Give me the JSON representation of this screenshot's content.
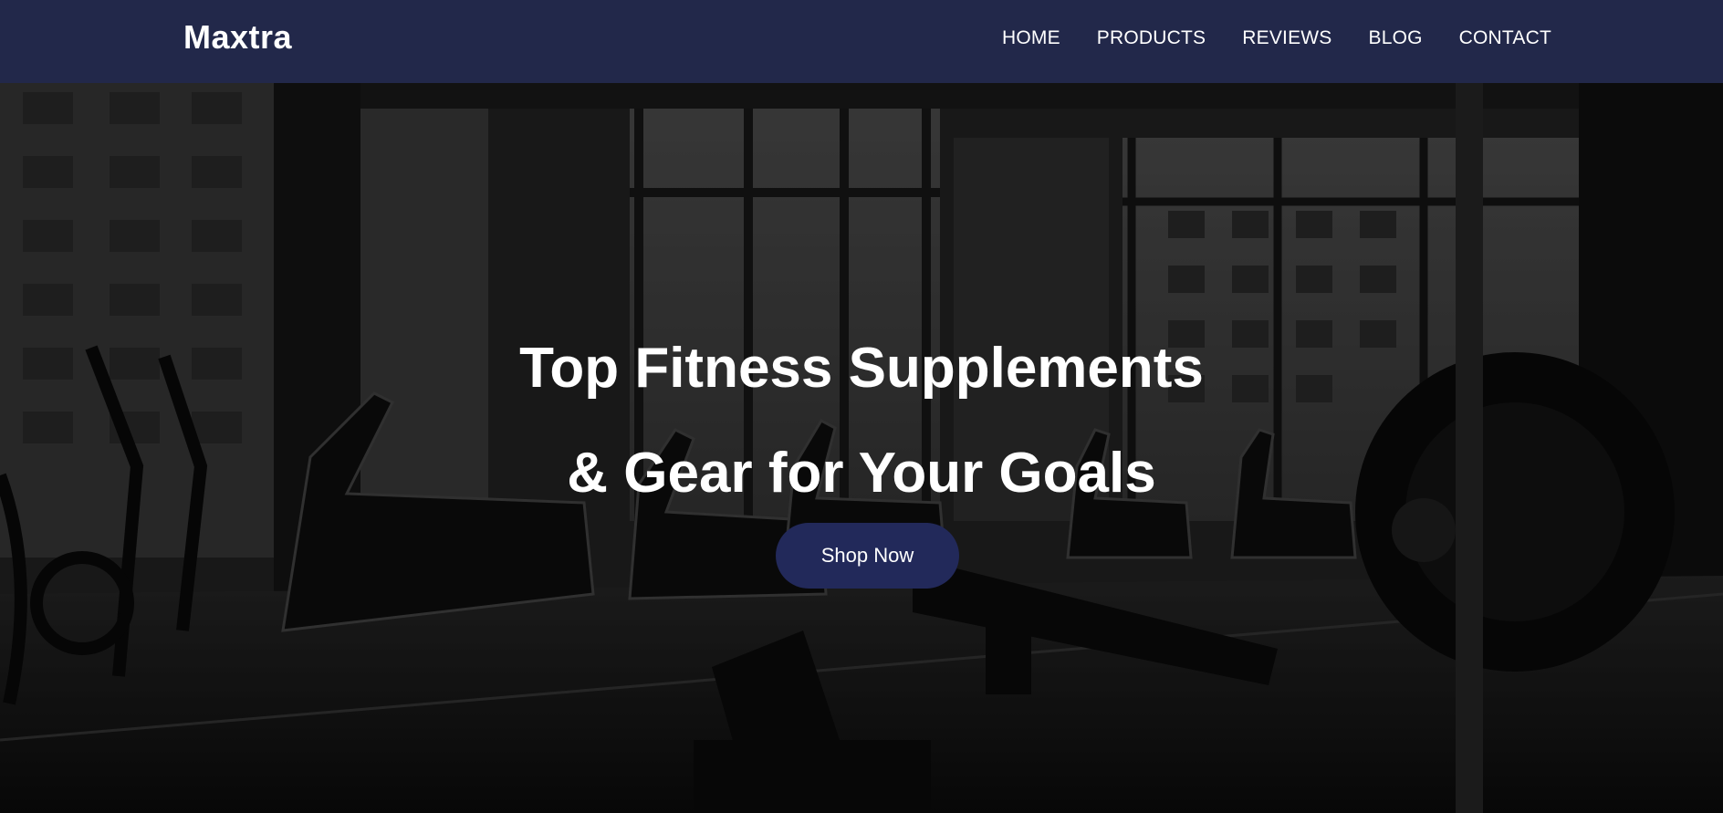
{
  "brand": {
    "name": "Maxtra"
  },
  "nav": {
    "items": [
      {
        "label": "HOME"
      },
      {
        "label": "PRODUCTS"
      },
      {
        "label": "REVIEWS"
      },
      {
        "label": "BLOG"
      },
      {
        "label": "CONTACT"
      }
    ]
  },
  "hero": {
    "title_line_1": "Top Fitness Supplements",
    "title_line_2": "& Gear for Your Goals",
    "cta_label": "Shop Now",
    "background_image": "gym-interior-photo"
  },
  "colors": {
    "nav_background": "#22284a",
    "cta_background": "#22295a",
    "text": "#ffffff"
  }
}
